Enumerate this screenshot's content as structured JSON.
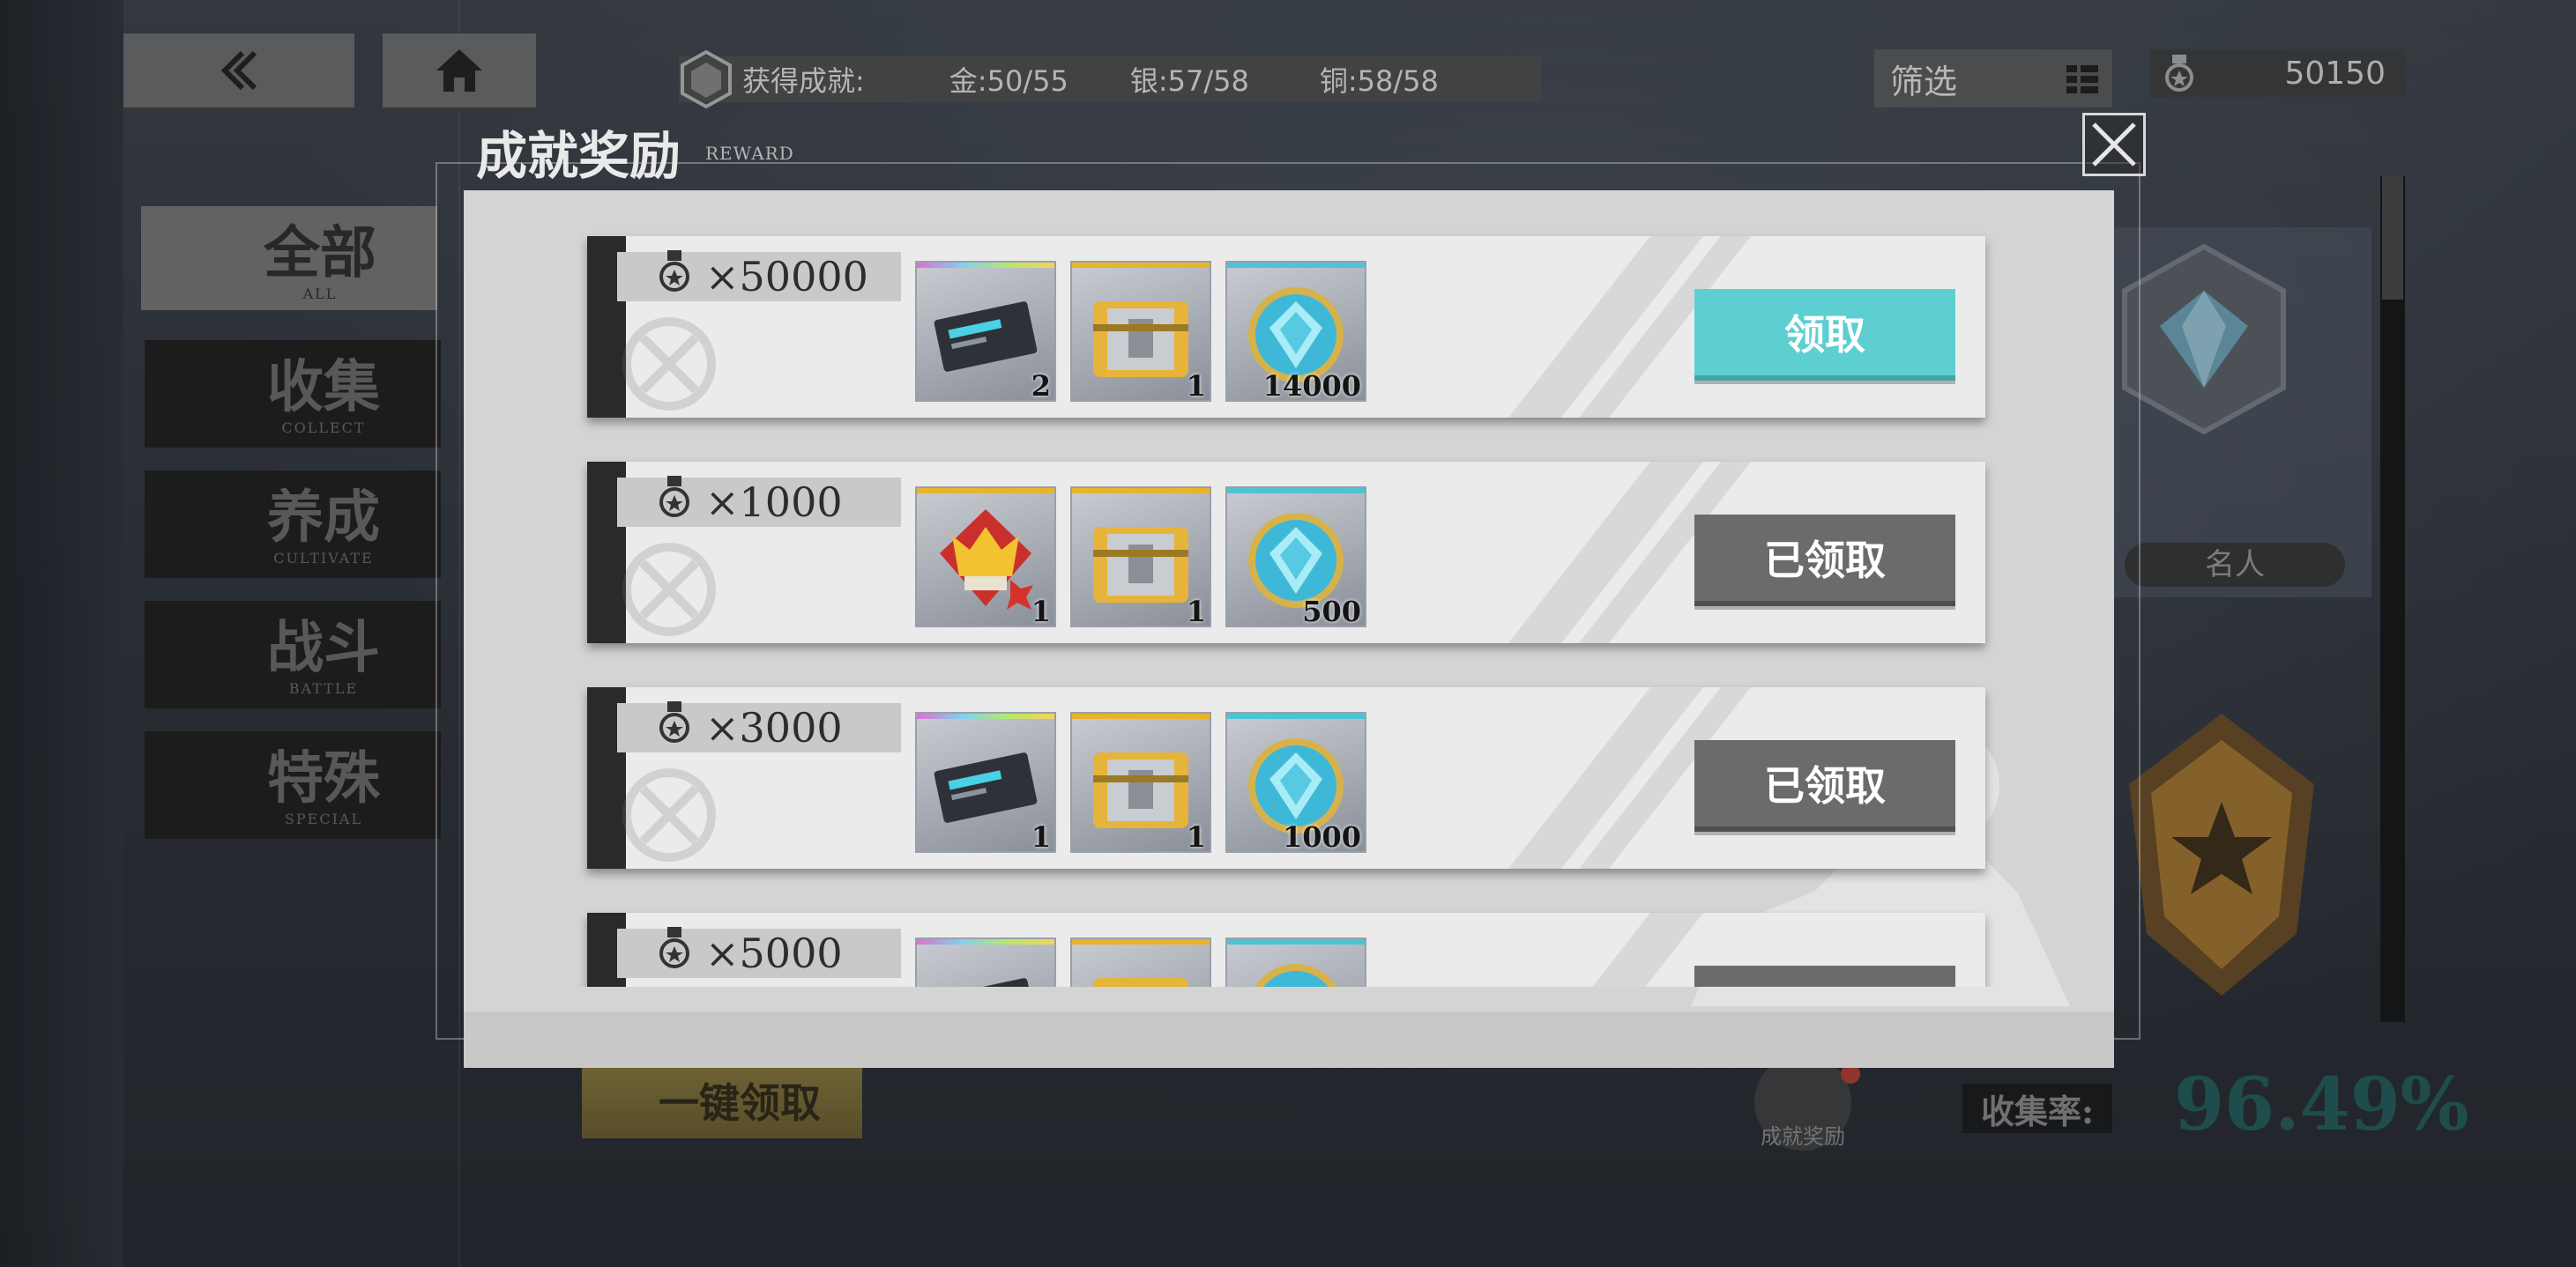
{
  "achievements": {
    "label": "获得成就:",
    "gold": "金:50/55",
    "silver": "银:57/58",
    "bronze": "铜:58/58"
  },
  "filter": {
    "label": "筛选"
  },
  "points_total": "50150",
  "categories": [
    {
      "zh": "全部",
      "en": "ALL"
    },
    {
      "zh": "收集",
      "en": "COLLECT"
    },
    {
      "zh": "养成",
      "en": "CULTIVATE"
    },
    {
      "zh": "战斗",
      "en": "BATTLE"
    },
    {
      "zh": "特殊",
      "en": "SPECIAL"
    }
  ],
  "side": {
    "title_label": "名人"
  },
  "bottom": {
    "one_click": "一键领取",
    "reward_icon_label": "成就奖励",
    "collect_rate_label": "收集率:",
    "collect_rate_value": "96.49%"
  },
  "modal": {
    "title": "成就奖励",
    "subtitle": "REWARD",
    "rows": [
      {
        "points": "×50000",
        "items": [
          {
            "icon": "data-chip-icon",
            "count": "2"
          },
          {
            "icon": "gold-chest-icon",
            "count": "1"
          },
          {
            "icon": "crystal-coin-icon",
            "count": "14000"
          }
        ],
        "button": "领取",
        "state": "available"
      },
      {
        "points": "×1000",
        "items": [
          {
            "icon": "crown-badge-icon",
            "count": "1"
          },
          {
            "icon": "gold-chest-icon",
            "count": "1"
          },
          {
            "icon": "crystal-coin-icon",
            "count": "500"
          }
        ],
        "button": "已领取",
        "state": "claimed"
      },
      {
        "points": "×3000",
        "items": [
          {
            "icon": "data-chip-icon",
            "count": "1"
          },
          {
            "icon": "gold-chest-icon",
            "count": "1"
          },
          {
            "icon": "crystal-coin-icon",
            "count": "1000"
          }
        ],
        "button": "已领取",
        "state": "claimed"
      },
      {
        "points": "×5000",
        "items": [
          {
            "icon": "data-chip-icon",
            "count": ""
          },
          {
            "icon": "gold-chest-icon",
            "count": ""
          },
          {
            "icon": "crystal-coin-icon",
            "count": ""
          }
        ],
        "button": "",
        "state": "claimed"
      }
    ]
  },
  "colors": {
    "claim_available": "#5dcfd1",
    "claim_done": "#6b6b6b",
    "rainbow_top": "#c77dd8",
    "gold_top": "#e8b42a",
    "cyan_top": "#4dc3d6",
    "collect_rate": "#1e5b58"
  }
}
